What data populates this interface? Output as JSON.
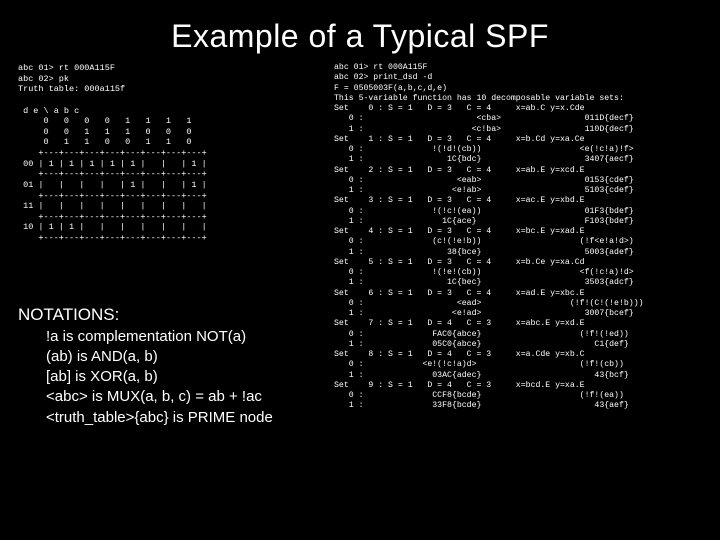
{
  "title": "Example of a Typical SPF",
  "left_block": "abc 01> rt 000A115F\nabc 02> pk\nTruth table: 000a115f\n\n d e \\ a b c\n     0   0   0   0   1   1   1   1\n     0   0   1   1   1   0   0   0\n     0   1   1   0   0   1   1   0\n    +---+---+---+---+---+---+---+---+\n 00 | 1 | 1 | 1 | 1 | 1 |   |   | 1 |\n    +---+---+---+---+---+---+---+---+\n 01 |   |   |   |   | 1 |   |   | 1 |\n    +---+---+---+---+---+---+---+---+\n 11 |   |   |   |   |   |   |   |   |\n    +---+---+---+---+---+---+---+---+\n 10 | 1 | 1 |   |   |   |   |   |   |\n    +---+---+---+---+---+---+---+---+",
  "notations": {
    "header": "NOTATIONS:",
    "lines": [
      "!a is complementation NOT(a)",
      "(ab) is AND(a, b)",
      "[ab] is XOR(a, b)",
      "<abc> is MUX(a, b, c) = ab + !ac",
      "<truth_table>{abc} is PRIME node"
    ]
  },
  "right_block": "abc 01> rt 000A115F\nabc 02> print_dsd -d\nF = 0505003F(a,b,c,d,e)\nThis 5-variable function has 10 decomposable variable sets:\nSet    0 : S = 1   D = 3   C = 4     x=ab.C y=x.Cde\n   0 :                       <cba>                 011D{decf}\n   1 :                      <c!ba>                 110D{decf}\nSet    1 : S = 1   D = 3   C = 4     x=b.Cd y=xa.Ce\n   0 :              !(!d!(cb))                    <e(!c!a)!f>\n   1 :                 1C{bdc}                     3407{aecf}\nSet    2 : S = 1   D = 3   C = 4     x=ab.E y=xcd.E\n   0 :                   <eab>                     0153{cdef}\n   1 :                  <e!ab>                     5103{cdef}\nSet    3 : S = 1   D = 3   C = 4     x=ac.E y=xbd.E\n   0 :              !(!c!(ea))                     01F3{bdef}\n   1 :                1C{ace}                      F103{bdef}\nSet    4 : S = 1   D = 3   C = 4     x=bc.E y=xad.E\n   0 :              (c!(!e!b))                    (!f<e!a!d>)\n   1 :                 38{bce}                     5003{adef}\nSet    5 : S = 1   D = 3   C = 4     x=b.Ce y=xa.Cd\n   0 :              !(!e!(cb))                    <f(!c!a)!d>\n   1 :                 1C{bec}                     3503{adcf}\nSet    6 : S = 1   D = 3   C = 4     x=ad.E y=xbc.E\n   0 :                   <ead>                  (!f!(C!(!e!b)))\n   1 :                  <e!ad>                     3007{bcef}\nSet    7 : S = 1   D = 4   C = 3     x=abc.E y=xd.E\n   0 :              FAC0{abce}                    (!f!(!ed))\n   1 :              05C0{abce}                       C1{def}\nSet    8 : S = 1   D = 4   C = 3     x=a.Cde y=xb.C\n   0 :            <e!(!c!a)d>                     (!f!(cb))\n   1 :              03AC{adec}                       43{bcf}\nSet    9 : S = 1   D = 4   C = 3     x=bcd.E y=xa.E\n   0 :              CCF8{bcde}                    (!f!(ea))\n   1 :              33F8{bcde}                       43{aef}"
}
